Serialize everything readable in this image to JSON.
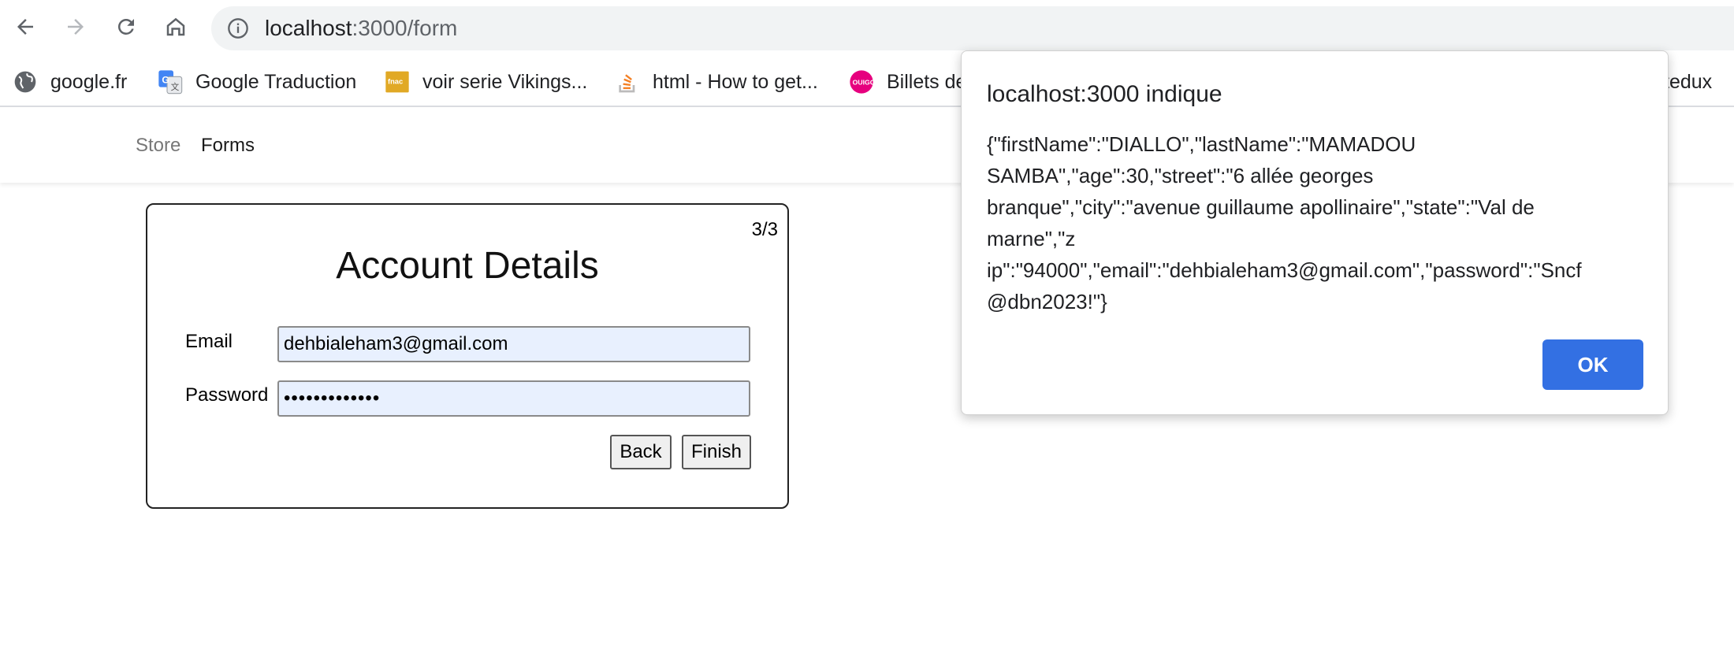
{
  "browser": {
    "url_host": "localhost",
    "url_path": ":3000/form",
    "bookmarks": [
      {
        "label": "google.fr",
        "icon": "globe-icon"
      },
      {
        "label": "Google Traduction",
        "icon": "google-translate-icon"
      },
      {
        "label": "voir serie Vikings...",
        "icon": "fnac-icon"
      },
      {
        "label": "html - How to get...",
        "icon": "stackoverflow-icon"
      },
      {
        "label": "Billets de",
        "icon": "ouigo-icon"
      },
      {
        "label": "tedux",
        "icon": ""
      }
    ]
  },
  "app_nav": {
    "store": "Store",
    "forms": "Forms"
  },
  "form": {
    "step": "3/3",
    "title": "Account Details",
    "email_label": "Email",
    "email_value": "dehbialeham3@gmail.com",
    "password_label": "Password",
    "password_value": "•••••••••••••",
    "back_label": "Back",
    "finish_label": "Finish"
  },
  "dialog": {
    "title": "localhost:3000 indique",
    "message": "{\"firstName\":\"DIALLO\",\"lastName\":\"MAMADOU SAMBA\",\"age\":30,\"street\":\"6 allée georges branque\",\"city\":\"avenue guillaume apollinaire\",\"state\":\"Val de marne\",\"zip\":\"94000\",\"email\":\"dehbialeham3@gmail.com\",\"password\":\"Sncf@dbn2023!\"}",
    "line1": "{\"firstName\":\"DIALLO\",\"lastName\":\"MAMADOU",
    "line2": "SAMBA\",\"age\":30,\"street\":\"6 allée georges",
    "line3": "branque\",\"city\":\"avenue guillaume apollinaire\",\"state\":\"Val de",
    "line4": "marne\",\"z",
    "line5": "ip\":\"94000\",\"email\":\"dehbialeham3@gmail.com\",\"password\":\"Sncf",
    "line6": "@dbn2023!\"}",
    "ok_label": "OK"
  }
}
